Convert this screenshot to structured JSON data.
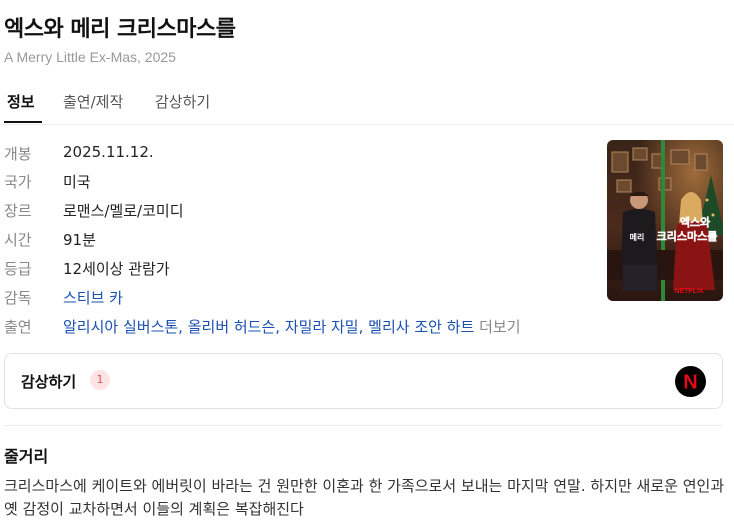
{
  "title": "엑스와 메리 크리스마스를",
  "subtitle": "A Merry Little Ex-Mas, 2025",
  "tabs": [
    {
      "label": "정보",
      "active": true
    },
    {
      "label": "출연/제작",
      "active": false
    },
    {
      "label": "감상하기",
      "active": false
    }
  ],
  "info": {
    "release": {
      "label": "개봉",
      "value": "2025.11.12."
    },
    "country": {
      "label": "국가",
      "value": "미국"
    },
    "genre": {
      "label": "장르",
      "value": "로맨스/멜로/코미디"
    },
    "runtime": {
      "label": "시간",
      "value": "91분"
    },
    "rating": {
      "label": "등급",
      "value": "12세이상 관람가"
    },
    "director": {
      "label": "감독",
      "value": "스티브 카"
    },
    "cast": {
      "label": "출연",
      "names": [
        "알리시아 실버스톤",
        "올리버 허드슨",
        "자밀라 자밀",
        "멜리사 조안 하트"
      ],
      "separator": ", ",
      "more": "더보기"
    }
  },
  "poster": {
    "title_line1": "엑스와",
    "title_line2": "메리",
    "title_line3": "크리스마스를",
    "brand": "NETFLIX",
    "brand_color": "#e50914"
  },
  "watch": {
    "title": "감상하기",
    "count": "1",
    "provider_icon": "netflix-icon",
    "provider_letter": "N",
    "provider_color": "#e50914"
  },
  "synopsis": {
    "title": "줄거리",
    "text": "크리스마스에 케이트와 에버릿이 바라는 건 원만한 이혼과 한 가족으로서 보내는 마지막 연말. 하지만 새로운 연인과 옛 감정이 교차하면서 이들의 계획은 복잡해진다"
  }
}
